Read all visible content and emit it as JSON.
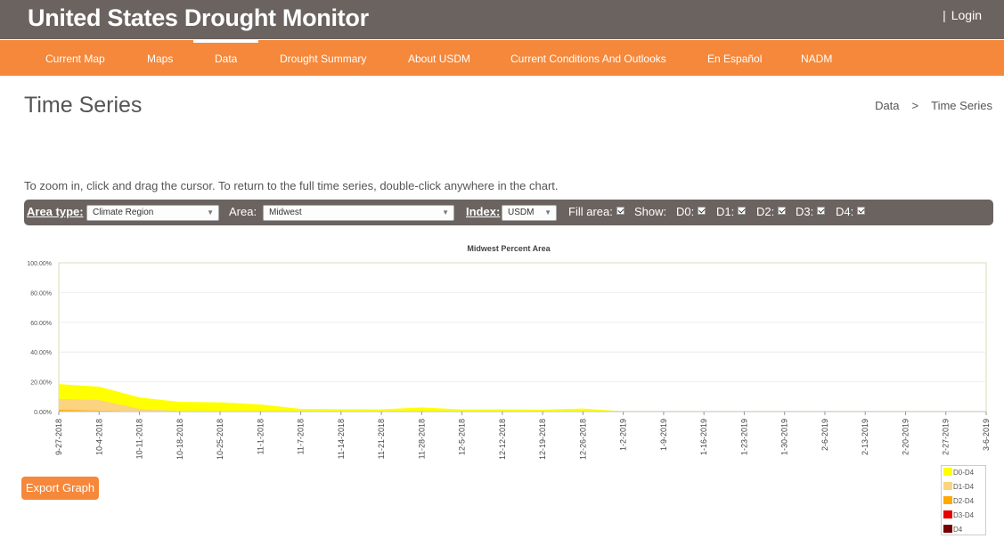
{
  "header": {
    "title": "United States Drought Monitor",
    "login_sep": "|",
    "login_label": "Login"
  },
  "nav": {
    "items": [
      {
        "label": "Current Map"
      },
      {
        "label": "Maps"
      },
      {
        "label": "Data"
      },
      {
        "label": "Drought Summary"
      },
      {
        "label": "About USDM"
      },
      {
        "label": "Current Conditions And Outlooks"
      },
      {
        "label": "En Español"
      },
      {
        "label": "NADM"
      }
    ],
    "active": "Data"
  },
  "page": {
    "title": "Time Series",
    "breadcrumb": {
      "parent": "Data",
      "sep": ">",
      "current": "Time Series"
    },
    "instructions": "To zoom in, click and drag the cursor. To return to the full time series, double-click anywhere in the chart."
  },
  "controls": {
    "area_type_label": "Area type:",
    "area_type_value": "Climate Region",
    "area_label": "Area:",
    "area_value": "Midwest",
    "index_label": "Index:",
    "index_value": "USDM",
    "fill_area_label": "Fill area:",
    "show_label": "Show:",
    "d0_label": "D0:",
    "d1_label": "D1:",
    "d2_label": "D2:",
    "d3_label": "D3:",
    "d4_label": "D4:",
    "arrow_icon": "chevron-down-icon"
  },
  "export_label": "Export Graph",
  "chart_data": {
    "type": "area",
    "title": "Midwest Percent Area",
    "ylim": [
      0,
      100
    ],
    "yticks": [
      "0.00%",
      "20.00%",
      "40.00%",
      "60.00%",
      "80.00%",
      "100.00%"
    ],
    "x": [
      "9-27-2018",
      "10-4-2018",
      "10-11-2018",
      "10-18-2018",
      "10-25-2018",
      "11-1-2018",
      "11-7-2018",
      "11-14-2018",
      "11-21-2018",
      "11-28-2018",
      "12-5-2018",
      "12-12-2018",
      "12-19-2018",
      "12-26-2018",
      "1-2-2019",
      "1-9-2019",
      "1-16-2019",
      "1-23-2019",
      "1-30-2019",
      "2-6-2019",
      "2-13-2019",
      "2-20-2019",
      "2-27-2019",
      "3-6-2019"
    ],
    "grid": true,
    "legend_position": "bottom-right",
    "series": [
      {
        "name": "D0-D4",
        "color": "#ffff00",
        "values": [
          18.5,
          16.8,
          9.5,
          6.5,
          6.2,
          4.8,
          1.8,
          1.6,
          1.5,
          2.8,
          1.4,
          1.5,
          1.3,
          2.0,
          0.2,
          0.2,
          0.1,
          0.1,
          0.1,
          0.1,
          0.1,
          0.1,
          0.1,
          0.1
        ]
      },
      {
        "name": "D1-D4",
        "color": "#fcd37f",
        "values": [
          8.5,
          7.8,
          1.8,
          0.4,
          0.3,
          0.2,
          0.1,
          0.1,
          0.1,
          0.1,
          0.1,
          0.1,
          0.1,
          0.1,
          0.0,
          0.0,
          0.0,
          0.0,
          0.0,
          0.0,
          0.0,
          0.0,
          0.0,
          0.0
        ]
      },
      {
        "name": "D2-D4",
        "color": "#ffaa00",
        "values": [
          1.2,
          0.6,
          0.1,
          0.0,
          0.0,
          0.0,
          0.0,
          0.0,
          0.0,
          0.0,
          0.0,
          0.0,
          0.0,
          0.0,
          0.0,
          0.0,
          0.0,
          0.0,
          0.0,
          0.0,
          0.0,
          0.0,
          0.0,
          0.0
        ]
      },
      {
        "name": "D3-D4",
        "color": "#e60000",
        "values": [
          0.0,
          0.0,
          0.0,
          0.0,
          0.0,
          0.0,
          0.0,
          0.0,
          0.0,
          0.0,
          0.0,
          0.0,
          0.0,
          0.0,
          0.0,
          0.0,
          0.0,
          0.0,
          0.0,
          0.0,
          0.0,
          0.0,
          0.0,
          0.0
        ]
      },
      {
        "name": "D4",
        "color": "#730000",
        "values": [
          0.0,
          0.0,
          0.0,
          0.0,
          0.0,
          0.0,
          0.0,
          0.0,
          0.0,
          0.0,
          0.0,
          0.0,
          0.0,
          0.0,
          0.0,
          0.0,
          0.0,
          0.0,
          0.0,
          0.0,
          0.0,
          0.0,
          0.0,
          0.0
        ]
      }
    ]
  }
}
